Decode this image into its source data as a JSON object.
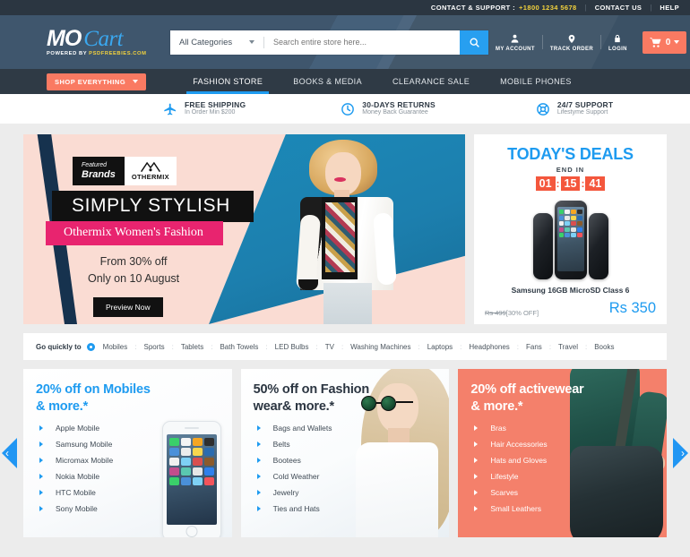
{
  "topbar": {
    "contact_label": "CONTACT & SUPPORT :",
    "phone": "+1800 1234 5678",
    "contact_us": "CONTACT US",
    "help": "HELP",
    "separator": "|"
  },
  "header": {
    "logo_primary": "MO",
    "logo_secondary": "Cart",
    "logo_tagline_prefix": "POWERED BY ",
    "logo_tagline_brand": "PSDFREEBIES.COM",
    "category_selected": "All Categories",
    "search_placeholder": "Search entire store here...",
    "search_value": "",
    "account_items": [
      {
        "label": "MY ACCOUNT",
        "icon": "user-icon"
      },
      {
        "label": "TRACK ORDER",
        "icon": "map-pin-icon"
      },
      {
        "label": "LOGIN",
        "icon": "lock-icon"
      }
    ],
    "cart_count": "0"
  },
  "nav": {
    "shop_everything": "SHOP EVERYTHING",
    "links": [
      {
        "label": "FASHION STORE",
        "active": true
      },
      {
        "label": "BOOKS & MEDIA",
        "active": false
      },
      {
        "label": "CLEARANCE SALE",
        "active": false
      },
      {
        "label": "MOBILE  PHONES",
        "active": false
      }
    ]
  },
  "features": [
    {
      "icon": "airplane-icon",
      "title": "FREE SHIPPING",
      "subtitle": "In Order Min $200"
    },
    {
      "icon": "clock-icon",
      "title": "30-DAYS RETURNS",
      "subtitle": "Money Back  Guarantee"
    },
    {
      "icon": "lifebuoy-icon",
      "title": "24/7 SUPPORT",
      "subtitle": "Lifestyme Support"
    }
  ],
  "hero": {
    "badge_featured": "Featured",
    "badge_brands": "Brands",
    "brand_mark": "ᴠᴠ",
    "brand_name": "OTHERMIX",
    "headline": "SIMPLY STYLISH",
    "subheadline": "Othermix Women's Fashion",
    "offer_line1": "From 30% off",
    "offer_line2": "Only on 10 August",
    "button": "Preview Now"
  },
  "deals": {
    "title": "TODAY'S DEALS",
    "end_in": "END IN",
    "timer": {
      "hours": "01",
      "minutes": "15",
      "seconds": "41",
      "colon": ":"
    },
    "product_name": "Samsung 16GB MicroSD Class 6",
    "old_price": "Rs 499",
    "discount": "[30% OFF]",
    "new_price": "Rs 350"
  },
  "quick_links": {
    "lead": "Go quickly to",
    "separator": ":",
    "items": [
      "Mobiles",
      "Sports",
      "Tablets",
      "Bath Towels",
      "LED Bulbs",
      "TV",
      "Washing Machines",
      "Laptops",
      "Headphones",
      "Fans",
      "Travel",
      "Books"
    ]
  },
  "promo_cards": [
    {
      "title_line1": "20% off on Mobiles",
      "title_line2": "& more.*",
      "items": [
        "Apple Mobile",
        "Samsung Mobile",
        "Micromax Mobile",
        "Nokia Mobile",
        "HTC Mobile",
        "Sony Mobile"
      ]
    },
    {
      "title_line1": "50% off on Fashion",
      "title_line2": "wear& more.*",
      "items": [
        "Bags and Wallets",
        "Belts",
        "Bootees",
        "Cold Weather",
        "Jewelry",
        "Ties and Hats"
      ]
    },
    {
      "title_line1": "20% off activewear",
      "title_line2": "& more.*",
      "items": [
        "Bras",
        "Hair Accessories",
        "Hats and Gloves",
        "Lifestyle",
        "Scarves",
        "Small Leathers"
      ]
    }
  ],
  "carousel": {
    "prev_icon": "chevron-left-icon",
    "next_icon": "chevron-right-icon",
    "prev_glyph": "‹",
    "next_glyph": "›"
  },
  "colors": {
    "accent_blue": "#1e9bf0",
    "accent_coral": "#fa7a62",
    "dark_navy": "#2b3641",
    "header_blue": "#3f566d",
    "yellow": "#f3d23d",
    "pink": "#e8246f"
  }
}
